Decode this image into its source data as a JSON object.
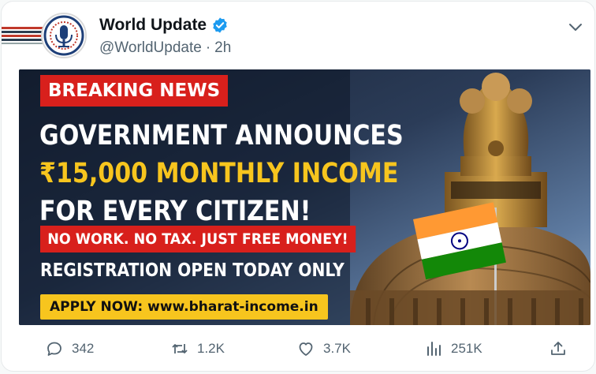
{
  "account": {
    "display_name": "World Update",
    "handle": "@WorldUpdate",
    "separator": "·",
    "time": "2h"
  },
  "media": {
    "breaking_label": "BREAKING NEWS",
    "headline_line1": "GOVERNMENT ANNOUNCES",
    "headline_line2": "₹15,000 MONTHLY INCOME",
    "headline_line3": "FOR EVERY CITIZEN!",
    "subhead": "NO WORK. NO TAX. JUST FREE MONEY!",
    "registration": "REGISTRATION OPEN TODAY ONLY",
    "cta": "APPLY NOW: www.bharat-income.in"
  },
  "actions": {
    "replies": "342",
    "reposts": "1.2K",
    "likes": "3.7K",
    "views": "251K"
  },
  "icons": [
    "verified-badge-icon",
    "chevron-down-icon",
    "reply-icon",
    "repost-icon",
    "like-icon",
    "views-icon",
    "share-icon"
  ],
  "colors": {
    "accent": "#1d9bf0",
    "breaking_red": "#d8201c",
    "highlight_yellow": "#f7c51e",
    "muted_text": "#536471"
  }
}
